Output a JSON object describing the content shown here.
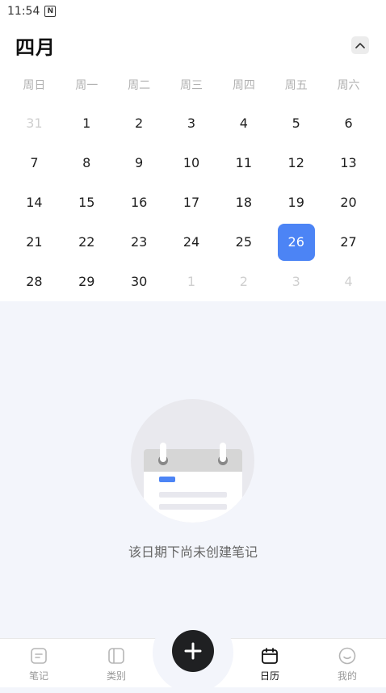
{
  "status_bar": {
    "time": "11:54",
    "notif_icon": "N"
  },
  "calendar": {
    "month_title": "四月",
    "weekdays": [
      "周日",
      "周一",
      "周二",
      "周三",
      "周四",
      "周五",
      "周六"
    ],
    "days": [
      {
        "label": "31",
        "muted": true
      },
      {
        "label": "1"
      },
      {
        "label": "2"
      },
      {
        "label": "3"
      },
      {
        "label": "4"
      },
      {
        "label": "5"
      },
      {
        "label": "6"
      },
      {
        "label": "7"
      },
      {
        "label": "8"
      },
      {
        "label": "9"
      },
      {
        "label": "10"
      },
      {
        "label": "11"
      },
      {
        "label": "12"
      },
      {
        "label": "13"
      },
      {
        "label": "14"
      },
      {
        "label": "15"
      },
      {
        "label": "16"
      },
      {
        "label": "17"
      },
      {
        "label": "18"
      },
      {
        "label": "19"
      },
      {
        "label": "20"
      },
      {
        "label": "21"
      },
      {
        "label": "22"
      },
      {
        "label": "23"
      },
      {
        "label": "24"
      },
      {
        "label": "25"
      },
      {
        "label": "26",
        "selected": true
      },
      {
        "label": "27"
      },
      {
        "label": "28"
      },
      {
        "label": "29"
      },
      {
        "label": "30"
      },
      {
        "label": "1",
        "muted": true
      },
      {
        "label": "2",
        "muted": true
      },
      {
        "label": "3",
        "muted": true
      },
      {
        "label": "4",
        "muted": true
      }
    ]
  },
  "empty_state": {
    "text": "该日期下尚未创建笔记"
  },
  "tabbar": {
    "tabs": [
      {
        "label": "笔记",
        "icon": "note-icon"
      },
      {
        "label": "类别",
        "icon": "category-icon"
      },
      {
        "label": "日历",
        "icon": "calendar-icon",
        "active": true
      },
      {
        "label": "我的",
        "icon": "profile-icon"
      }
    ],
    "fab_icon": "plus-icon"
  },
  "colors": {
    "accent": "#4c84f5",
    "fab": "#1f2022",
    "empty_bg": "#f3f5fb"
  }
}
